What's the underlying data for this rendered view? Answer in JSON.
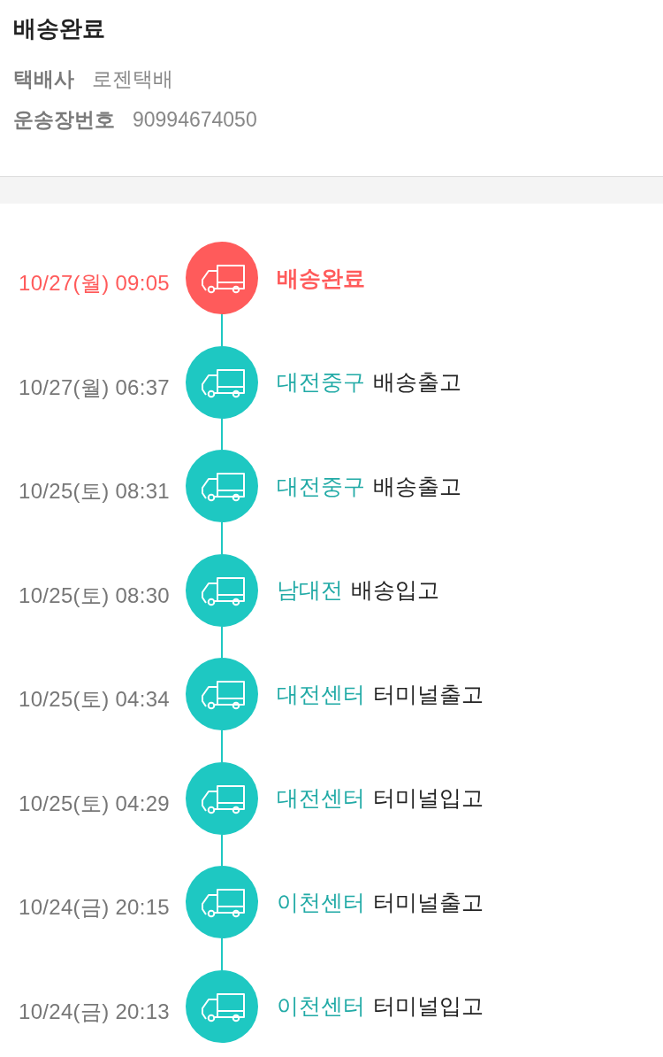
{
  "header": {
    "title": "배송완료",
    "fields": [
      {
        "label": "택배사",
        "value": "로젠택배"
      },
      {
        "label": "운송장번호",
        "value": "90994674050"
      }
    ]
  },
  "timeline": [
    {
      "time": "10/27(월) 09:05",
      "status": "배송완료",
      "current": true
    },
    {
      "time": "10/27(월) 06:37",
      "location": "대전중구",
      "status": "배송출고",
      "current": false
    },
    {
      "time": "10/25(토) 08:31",
      "location": "대전중구",
      "status": "배송출고",
      "current": false
    },
    {
      "time": "10/25(토) 08:30",
      "location": "남대전",
      "status": "배송입고",
      "current": false
    },
    {
      "time": "10/25(토) 04:34",
      "location": "대전센터",
      "status": "터미널출고",
      "current": false
    },
    {
      "time": "10/25(토) 04:29",
      "location": "대전센터",
      "status": "터미널입고",
      "current": false
    },
    {
      "time": "10/24(금) 20:15",
      "location": "이천센터",
      "status": "터미널출고",
      "current": false
    },
    {
      "time": "10/24(금) 20:13",
      "location": "이천센터",
      "status": "터미널입고",
      "current": false
    }
  ]
}
